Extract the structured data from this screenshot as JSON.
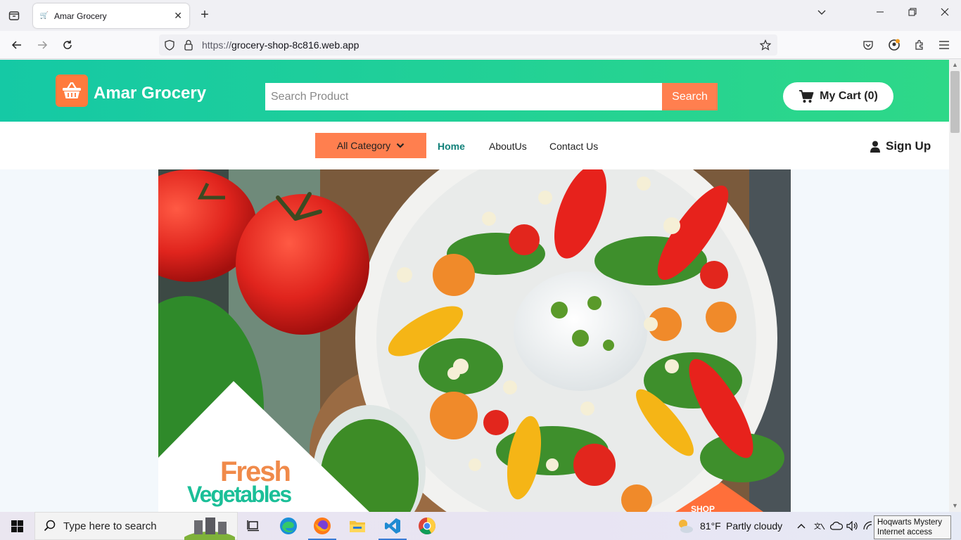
{
  "browser": {
    "tab_title": "Amar Grocery",
    "url_protocol": "https://",
    "url_host": "grocery-shop-8c816.web.app"
  },
  "site": {
    "brand": "Amar Grocery",
    "search_placeholder": "Search Product",
    "search_button": "Search",
    "cart_label": "My Cart (0)",
    "category_button": "All Category",
    "menu": [
      "Home",
      "AboutUs",
      "Contact Us"
    ],
    "active_menu": "Home",
    "signup_label": "Sign Up",
    "hero": {
      "headline_1": "Fresh",
      "headline_2": "Vegetables",
      "corner_badge": "SHOP"
    },
    "colors": {
      "header_start": "#15c9a5",
      "header_end": "#2ed888",
      "accent_orange": "#ff7f4f",
      "active_link": "#12817a"
    }
  },
  "taskbar": {
    "search_placeholder": "Type here to search",
    "weather_temp": "81°F",
    "weather_desc": "Partly cloudy",
    "tooltip_line1": "Hoqwarts Mystery",
    "tooltip_line2": "Internet access"
  }
}
